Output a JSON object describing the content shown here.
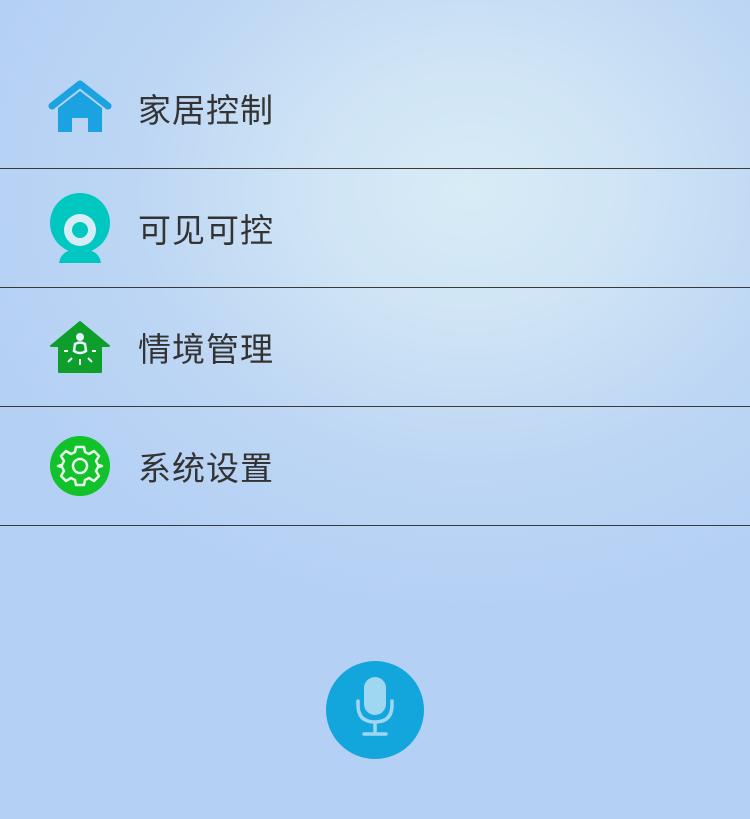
{
  "menu": {
    "items": [
      {
        "label": "家居控制",
        "icon": "home-icon",
        "color": "#1aa3e0"
      },
      {
        "label": "可见可控",
        "icon": "webcam-icon",
        "color": "#00c8c0"
      },
      {
        "label": "情境管理",
        "icon": "scene-house-icon",
        "color": "#0e9e2a"
      },
      {
        "label": "系统设置",
        "icon": "gear-icon",
        "color": "#12c22a"
      }
    ]
  },
  "voice": {
    "icon": "microphone-icon",
    "color": "#13a6dc"
  }
}
